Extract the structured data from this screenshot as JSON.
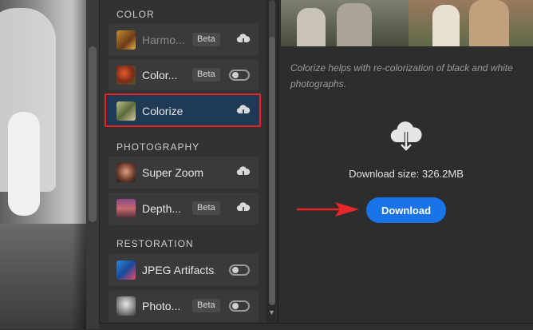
{
  "sections": {
    "color": "COLOR",
    "photography": "PHOTOGRAPHY",
    "restoration": "RESTORATION"
  },
  "filters": [
    {
      "label": "Harmo...",
      "badge": "Beta",
      "control": "cloud-download"
    },
    {
      "label": "Color...",
      "badge": "Beta",
      "control": "toggle-off"
    },
    {
      "label": "Colorize",
      "badge": "",
      "control": "cloud-download",
      "selected": true
    },
    {
      "label": "Super Zoom",
      "badge": "",
      "control": "cloud-download"
    },
    {
      "label": "Depth...",
      "badge": "Beta",
      "control": "cloud-download"
    },
    {
      "label": "JPEG Artifacts...",
      "badge": "",
      "control": "toggle-off"
    },
    {
      "label": "Photo...",
      "badge": "Beta",
      "control": "toggle-off"
    }
  ],
  "info": {
    "description": "Colorize helps with re-colorization of black and white photographs.",
    "download_size": "Download size: 326.2MB",
    "download_button": "Download"
  },
  "colors": {
    "accent": "#1a73e8",
    "selected_bg": "#1f3a55",
    "highlight": "#e8262a"
  }
}
